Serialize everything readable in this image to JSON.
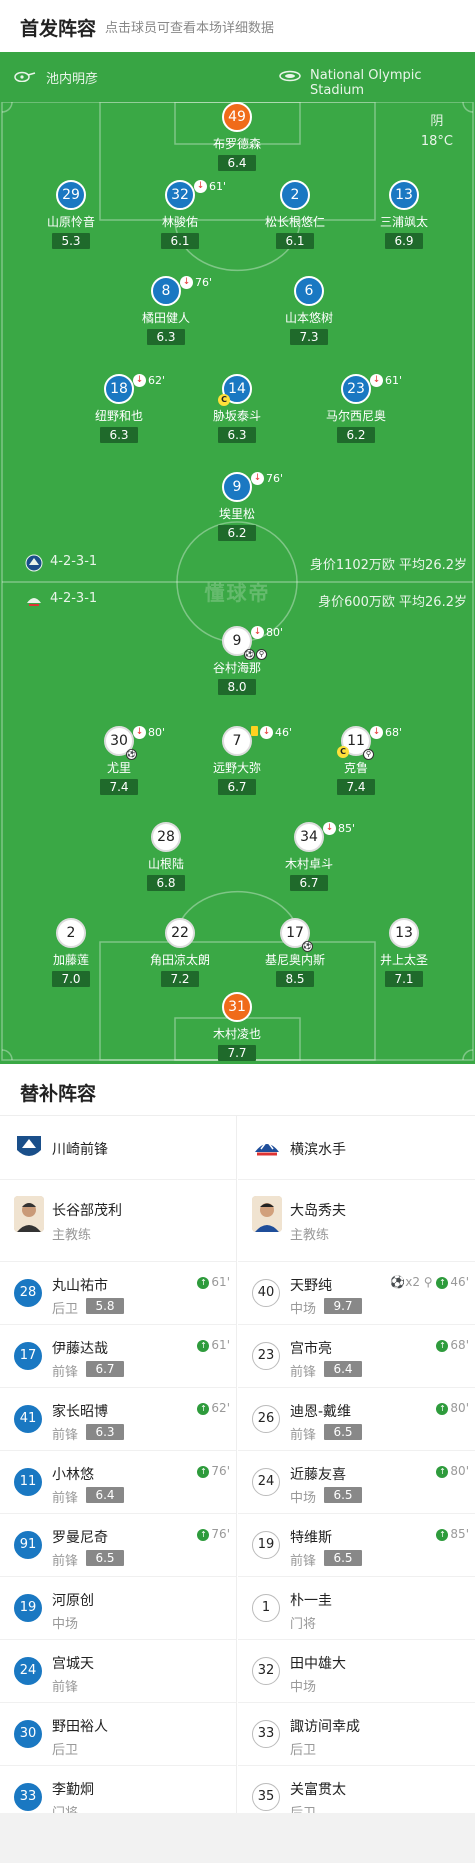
{
  "header": {
    "title": "首发阵容",
    "subtitle": "点击球员可查看本场详细数据"
  },
  "venue": {
    "coach": "池内明彦",
    "stadium": "National Olympic Stadium"
  },
  "weather": {
    "condition": "阴",
    "temp": "18°C"
  },
  "home_info": {
    "formation": "4-2-3-1",
    "value": "身价1102万欧  平均26.2岁"
  },
  "away_info": {
    "formation": "4-2-3-1",
    "value": "身价600万欧  平均26.2岁"
  },
  "watermark": "懂球帝",
  "colors": {
    "pitch": "#3aa845",
    "home": "#1a78c2",
    "keeper": "#f06b1a",
    "away": "#ffffff"
  },
  "home_players": [
    {
      "num": "49",
      "name": "布罗德森",
      "rating": "6.4",
      "color": "orange"
    },
    {
      "num": "29",
      "name": "山原怜音",
      "rating": "5.3",
      "color": "blue"
    },
    {
      "num": "32",
      "name": "林骏佑",
      "rating": "6.1",
      "color": "blue",
      "sub": "61'"
    },
    {
      "num": "2",
      "name": "松长根悠仁",
      "rating": "6.1",
      "color": "blue"
    },
    {
      "num": "13",
      "name": "三浦飒太",
      "rating": "6.9",
      "color": "blue"
    },
    {
      "num": "8",
      "name": "橘田健人",
      "rating": "6.3",
      "color": "blue",
      "sub": "76'"
    },
    {
      "num": "6",
      "name": "山本悠树",
      "rating": "7.3",
      "color": "blue"
    },
    {
      "num": "18",
      "name": "纽野和也",
      "rating": "6.3",
      "color": "blue",
      "sub": "62'"
    },
    {
      "num": "14",
      "name": "胁坂泰斗",
      "rating": "6.3",
      "color": "blue",
      "captain": "C"
    },
    {
      "num": "23",
      "name": "马尔西尼奥",
      "rating": "6.2",
      "color": "blue",
      "sub": "61'"
    },
    {
      "num": "9",
      "name": "埃里松",
      "rating": "6.2",
      "color": "blue",
      "sub": "76'"
    }
  ],
  "away_players": [
    {
      "num": "9",
      "name": "谷村海那",
      "rating": "8.0",
      "color": "white",
      "sub": "80'"
    },
    {
      "num": "30",
      "name": "尤里",
      "rating": "7.4",
      "color": "white",
      "sub": "80'"
    },
    {
      "num": "7",
      "name": "远野大弥",
      "rating": "6.7",
      "color": "white",
      "sub": "46'"
    },
    {
      "num": "11",
      "name": "克鲁",
      "rating": "7.4",
      "color": "white",
      "sub": "68'",
      "captain": "C"
    },
    {
      "num": "28",
      "name": "山根陆",
      "rating": "6.8",
      "color": "white"
    },
    {
      "num": "34",
      "name": "木村卓斗",
      "rating": "6.7",
      "color": "white",
      "sub": "85'"
    },
    {
      "num": "2",
      "name": "加藤莲",
      "rating": "7.0",
      "color": "white"
    },
    {
      "num": "22",
      "name": "角田凉太朗",
      "rating": "7.2",
      "color": "white"
    },
    {
      "num": "17",
      "name": "基尼奥内斯",
      "rating": "8.5",
      "color": "white"
    },
    {
      "num": "13",
      "name": "井上太圣",
      "rating": "7.1",
      "color": "white"
    },
    {
      "num": "31",
      "name": "木村凌也",
      "rating": "7.7",
      "color": "orange"
    }
  ],
  "subs": {
    "title": "替补阵容",
    "home": {
      "team": "川崎前锋",
      "coach": {
        "name": "长谷部茂利",
        "role": "主教练"
      },
      "players": [
        {
          "num": "28",
          "name": "丸山祐市",
          "pos": "后卫",
          "rating": "5.8",
          "time": "61'"
        },
        {
          "num": "17",
          "name": "伊藤达哉",
          "pos": "前锋",
          "rating": "6.7",
          "time": "61'"
        },
        {
          "num": "41",
          "name": "家长昭博",
          "pos": "前锋",
          "rating": "6.3",
          "time": "62'"
        },
        {
          "num": "11",
          "name": "小林悠",
          "pos": "前锋",
          "rating": "6.4",
          "time": "76'"
        },
        {
          "num": "91",
          "name": "罗曼尼奇",
          "pos": "前锋",
          "rating": "6.5",
          "time": "76'"
        },
        {
          "num": "19",
          "name": "河原创",
          "pos": "中场",
          "rating": "",
          "time": ""
        },
        {
          "num": "24",
          "name": "宫城天",
          "pos": "前锋",
          "rating": "",
          "time": ""
        },
        {
          "num": "30",
          "name": "野田裕人",
          "pos": "后卫",
          "rating": "",
          "time": ""
        },
        {
          "num": "33",
          "name": "李勤炯",
          "pos": "门将",
          "rating": "",
          "time": ""
        }
      ]
    },
    "away": {
      "team": "横滨水手",
      "coach": {
        "name": "大岛秀夫",
        "role": "主教练"
      },
      "players": [
        {
          "num": "40",
          "name": "天野纯",
          "pos": "中场",
          "rating": "9.7",
          "time": "46'",
          "extra": "⚽x2 ⚲"
        },
        {
          "num": "23",
          "name": "宫市亮",
          "pos": "前锋",
          "rating": "6.4",
          "time": "68'"
        },
        {
          "num": "26",
          "name": "迪恩-戴维",
          "pos": "前锋",
          "rating": "6.5",
          "time": "80'"
        },
        {
          "num": "24",
          "name": "近藤友喜",
          "pos": "中场",
          "rating": "6.5",
          "time": "80'"
        },
        {
          "num": "19",
          "name": "特维斯",
          "pos": "前锋",
          "rating": "6.5",
          "time": "85'"
        },
        {
          "num": "1",
          "name": "朴一圭",
          "pos": "门将",
          "rating": "",
          "time": ""
        },
        {
          "num": "32",
          "name": "田中雄大",
          "pos": "中场",
          "rating": "",
          "time": ""
        },
        {
          "num": "33",
          "name": "諏访间幸成",
          "pos": "后卫",
          "rating": "",
          "time": ""
        },
        {
          "num": "35",
          "name": "关富贯太",
          "pos": "后卫",
          "rating": "",
          "time": ""
        }
      ]
    }
  }
}
